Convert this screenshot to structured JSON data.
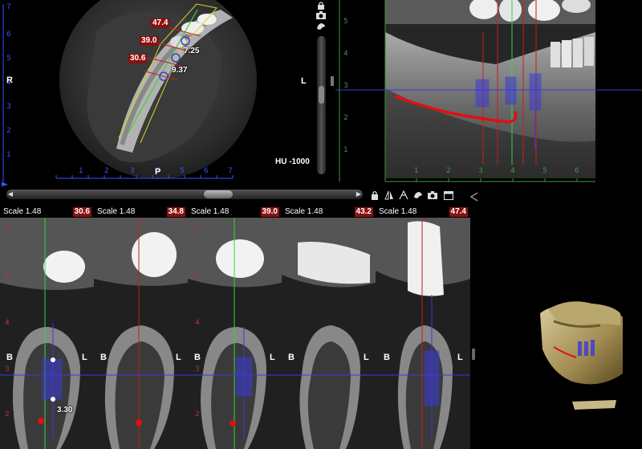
{
  "axial": {
    "orient_right": "R",
    "orient_left": "L",
    "orient_posterior": "P",
    "measurements": [
      {
        "label": "47.4"
      },
      {
        "label": "39.0"
      },
      {
        "label": "30.6"
      },
      {
        "label": "7.25"
      },
      {
        "label": "9.37"
      }
    ],
    "left_ruler_ticks": [
      "7",
      "6",
      "5",
      "4",
      "3",
      "2",
      "1"
    ],
    "bottom_ruler_ticks": [
      "1",
      "2",
      "3",
      "4",
      "5",
      "6",
      "7"
    ]
  },
  "window": {
    "hu_label": "HU -1000"
  },
  "panoramic": {
    "left_ruler_ticks": [
      "5",
      "4",
      "3",
      "2",
      "1"
    ],
    "bottom_ruler_ticks": [
      "1",
      "2",
      "3",
      "4",
      "5",
      "6"
    ]
  },
  "toolbar": {
    "icons": [
      "lock-icon",
      "flip-icon",
      "mirror-icon",
      "tooth-icon",
      "camera-icon",
      "window-icon"
    ]
  },
  "slices": [
    {
      "scale": "Scale 1.48",
      "position": "30.6",
      "left": "B",
      "right": "L",
      "measure": "3.30"
    },
    {
      "scale": "Scale 1.48",
      "position": "34.8",
      "left": "B",
      "right": "L",
      "measure": ""
    },
    {
      "scale": "Scale 1.48",
      "position": "39.0",
      "left": "B",
      "right": "L",
      "measure": ""
    },
    {
      "scale": "Scale 1.48",
      "position": "43.2",
      "left": "B",
      "right": "L",
      "measure": ""
    },
    {
      "scale": "Scale 1.48",
      "position": "47.4",
      "left": "B",
      "right": "L",
      "measure": ""
    }
  ],
  "slice_ruler_ticks": [
    "6",
    "5",
    "4",
    "3",
    "2"
  ],
  "colors": {
    "nerve": "#e01010",
    "implant": "#3a3ad8",
    "guide_green": "#3bd13b",
    "guide_red": "#c02020",
    "ruler_blue": "#3355ff"
  }
}
